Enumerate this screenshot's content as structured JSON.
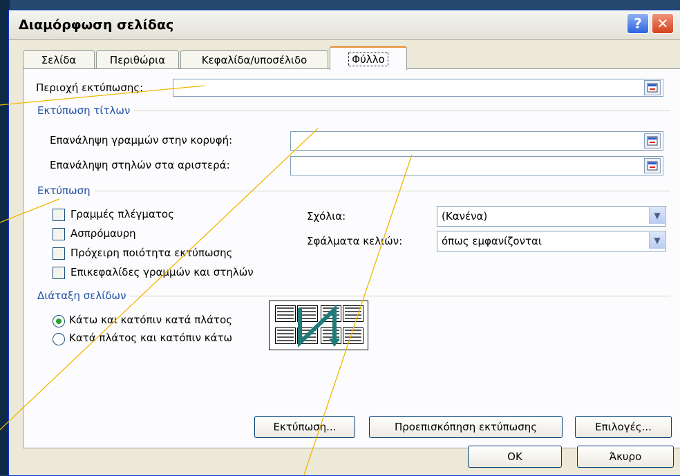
{
  "dialog": {
    "title": "Διαμόρφωση σελίδας",
    "help_symbol": "?",
    "close_symbol": "✕"
  },
  "tabs": [
    {
      "label": "Σελίδα"
    },
    {
      "label": "Περιθώρια"
    },
    {
      "label": "Κεφαλίδα/υποσέλιδο"
    },
    {
      "label": "Φύλλο"
    }
  ],
  "print_area": {
    "label": "Περιοχή εκτύπωσης:",
    "value": ""
  },
  "print_titles": {
    "group": "Εκτύπωση τίτλων",
    "rows_label": "Επανάληψη γραμμών στην κορυφή:",
    "rows_value": "",
    "cols_label": "Επανάληψη στηλών στα αριστερά:",
    "cols_value": ""
  },
  "print": {
    "group": "Εκτύπωση",
    "checkboxes": [
      {
        "label": "Γραμμές πλέγματος",
        "checked": false
      },
      {
        "label": "Ασπρόμαυρη",
        "checked": false
      },
      {
        "label": "Πρόχειρη ποιότητα εκτύπωσης",
        "checked": false
      },
      {
        "label": "Επικεφαλίδες γραμμών και στηλών",
        "checked": false
      }
    ],
    "comments_label": "Σχόλια:",
    "comments_value": "(Κανένα)",
    "errors_label": "Σφάλματα κελιών:",
    "errors_value": "όπως εμφανίζονται"
  },
  "page_order": {
    "group": "Διάταξη σελίδων",
    "options": [
      {
        "label": "Κάτω και κατόπιν κατά πλάτος",
        "selected": true
      },
      {
        "label": "Κατά πλάτος και κατόπιν κάτω",
        "selected": false
      }
    ]
  },
  "buttons": {
    "print": "Εκτύπωση...",
    "preview": "Προεπισκόπηση εκτύπωσης",
    "options": "Επιλογές...",
    "ok": "OK",
    "cancel": "Άκυρο"
  },
  "colors": {
    "accent_line": "#f2b600",
    "group_title": "#1b4fa5",
    "arrow": "#1f7a7a"
  }
}
